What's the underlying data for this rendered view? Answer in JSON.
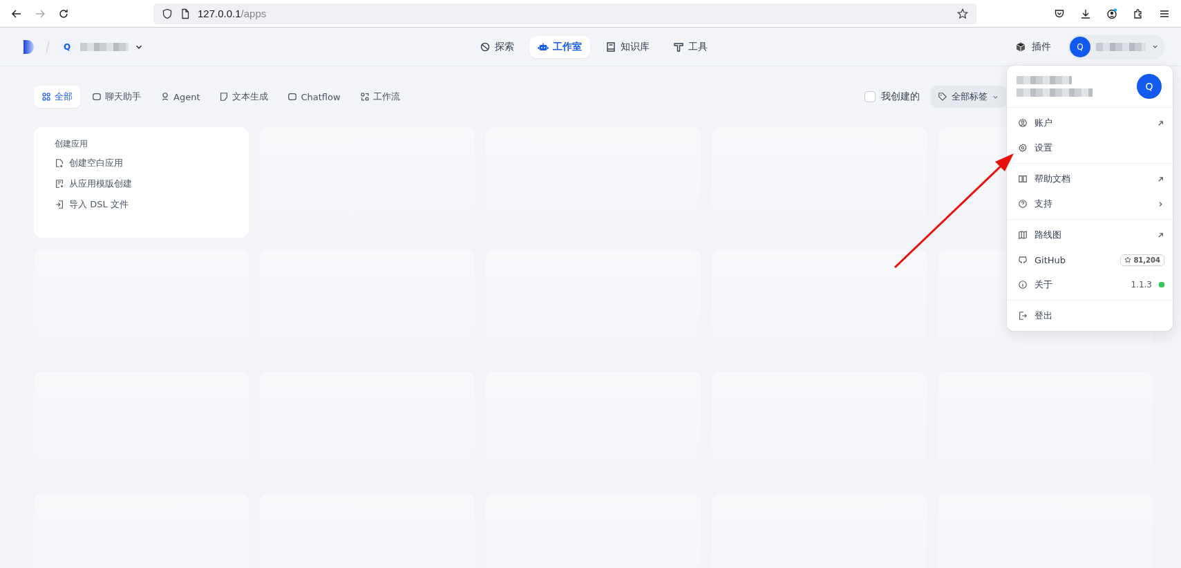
{
  "browser": {
    "url_host": "127.0.0.1",
    "url_path": "/apps",
    "forward_disabled": true,
    "account_badge": true
  },
  "header": {
    "workspace_initial": "Q",
    "nav": [
      {
        "label": "探索",
        "selected": false
      },
      {
        "label": "工作室",
        "selected": true
      },
      {
        "label": "知识库",
        "selected": false
      },
      {
        "label": "工具",
        "selected": false
      }
    ],
    "plugins": "插件",
    "user_initial": "Q"
  },
  "filters": {
    "tabs": [
      {
        "label": "全部",
        "selected": true
      },
      {
        "label": "聊天助手",
        "selected": false
      },
      {
        "label": "Agent",
        "selected": false
      },
      {
        "label": "文本生成",
        "selected": false
      },
      {
        "label": "Chatflow",
        "selected": false
      },
      {
        "label": "工作流",
        "selected": false
      }
    ],
    "my_created": {
      "label": "我创建的",
      "checked": false
    },
    "tags": "全部标签"
  },
  "create_card": {
    "title": "创建应用",
    "actions": [
      "创建空白应用",
      "从应用模版创建",
      "导入 DSL 文件"
    ]
  },
  "app_cards": [
    {
      "kind": "skeleton"
    },
    {
      "kind": "skeleton"
    },
    {
      "kind": "skeleton"
    },
    {
      "kind": "skeleton"
    },
    {
      "kind": "skeleton"
    },
    {
      "kind": "skeleton"
    },
    {
      "kind": "skeleton"
    },
    {
      "kind": "skeleton"
    },
    {
      "kind": "skeleton"
    },
    {
      "kind": "skeleton"
    },
    {
      "kind": "skeleton"
    },
    {
      "kind": "skeleton"
    },
    {
      "kind": "skeleton"
    },
    {
      "kind": "skeleton"
    },
    {
      "kind": "skeleton"
    },
    {
      "kind": "skeleton"
    },
    {
      "kind": "skeleton"
    },
    {
      "kind": "skeleton"
    },
    {
      "kind": "skeleton"
    }
  ],
  "menu": {
    "avatar": "Q",
    "groups": [
      [
        {
          "label": "账户",
          "kind": "external"
        },
        {
          "label": "设置",
          "kind": "plain"
        }
      ],
      [
        {
          "label": "帮助文档",
          "kind": "external"
        },
        {
          "label": "支持",
          "kind": "submenu"
        }
      ],
      [
        {
          "label": "路线图",
          "kind": "external"
        },
        {
          "label": "GitHub",
          "kind": "stars",
          "badge": "81,204"
        },
        {
          "label": "关于",
          "kind": "version",
          "version": "1.1.3",
          "color": "#34c759"
        }
      ],
      [
        {
          "label": "登出",
          "kind": "plain"
        }
      ]
    ]
  },
  "annotation": {
    "kind": "arrow"
  }
}
